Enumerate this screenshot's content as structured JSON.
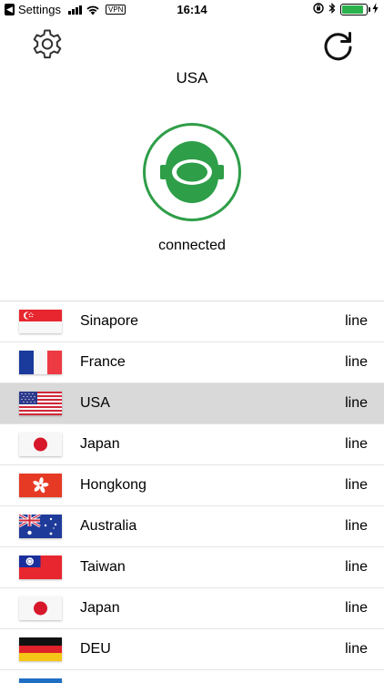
{
  "status_bar": {
    "back_app": "Settings",
    "vpn": "VPN",
    "time": "16:14",
    "battery_level": 0.9
  },
  "header": {
    "location": "USA"
  },
  "connection": {
    "status": "connected",
    "accent_color": "#2e9e48"
  },
  "servers": [
    {
      "name": "Sinapore",
      "status": "line",
      "flag": "singapore-flag"
    },
    {
      "name": "France",
      "status": "line",
      "flag": "france-flag"
    },
    {
      "name": "USA",
      "status": "line",
      "flag": "usa-flag",
      "selected": true
    },
    {
      "name": "Japan",
      "status": "line",
      "flag": "japan-flag"
    },
    {
      "name": "Hongkong",
      "status": "line",
      "flag": "hongkong-flag"
    },
    {
      "name": "Australia",
      "status": "line",
      "flag": "australia-flag"
    },
    {
      "name": "Taiwan",
      "status": "line",
      "flag": "taiwan-flag"
    },
    {
      "name": "Japan",
      "status": "line",
      "flag": "japan-flag"
    },
    {
      "name": "DEU",
      "status": "line",
      "flag": "germany-flag"
    },
    {
      "name": "",
      "status": "",
      "flag": "partial-flag"
    }
  ]
}
